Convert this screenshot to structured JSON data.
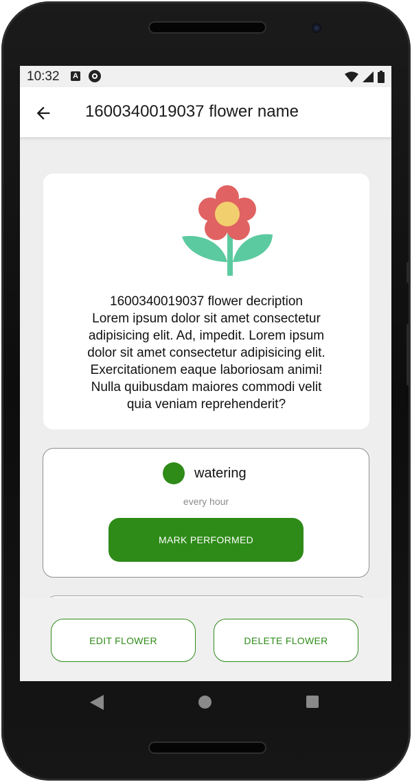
{
  "status_bar": {
    "time": "10:32",
    "notification_icons": [
      "a-icon",
      "app-icon"
    ],
    "system_icons": [
      "wifi-icon",
      "signal-icon",
      "battery-icon"
    ]
  },
  "app_bar": {
    "back_icon": "arrow-left-icon",
    "title": "1600340019037 flower name"
  },
  "flower_card": {
    "image": "flower-icon",
    "description": "1600340019037 flower decription\nLorem ipsum dolor sit amet consectetur\nadipisicing elit. Ad, impedit. Lorem ipsum\ndolor sit amet consectetur adipisicing elit.\nExercitationem eaque laboriosam animi!\nNulla quibusdam maiores commodi velit\nquia veniam reprehenderit?"
  },
  "task": {
    "name": "watering",
    "frequency": "every hour",
    "dot_color": "#2e8b18",
    "action_label": "MARK PERFORMED"
  },
  "actions": {
    "edit_label": "EDIT FLOWER",
    "delete_label": "DELETE FLOWER"
  },
  "colors": {
    "accent": "#2e8b18",
    "petal": "#e06262",
    "center": "#f2cf6e",
    "leaf": "#5ccaa0"
  },
  "nav_bar": {
    "icons": [
      "nav-back-icon",
      "nav-home-icon",
      "nav-recents-icon"
    ]
  }
}
